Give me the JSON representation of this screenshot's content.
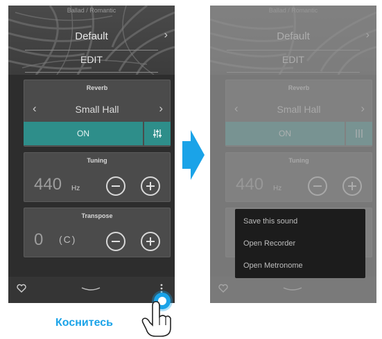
{
  "sound": {
    "category": "Ballad / Romantic",
    "name": "Default",
    "edit_label": "EDIT"
  },
  "reverb": {
    "title": "Reverb",
    "value": "Small Hall",
    "toggle_label": "ON"
  },
  "tuning": {
    "title": "Tuning",
    "value": "440",
    "unit": "Hz"
  },
  "transpose": {
    "title": "Transpose",
    "value": "0",
    "key": "(C)"
  },
  "menu": {
    "items": [
      {
        "label": "Save this sound"
      },
      {
        "label": "Open Recorder"
      },
      {
        "label": "Open Metronome"
      }
    ]
  },
  "hint": {
    "tap_label": "Коснитесь"
  },
  "colors": {
    "accent": "#2e8e8a",
    "hint_blue": "#1aa3e8",
    "panel_bg": "#2d2d2d"
  },
  "icons": {
    "favorite": "heart-icon",
    "more": "kebab-menu-icon",
    "settings": "sliders-icon",
    "next": "chevron-right-icon",
    "prev": "chevron-left-icon"
  }
}
